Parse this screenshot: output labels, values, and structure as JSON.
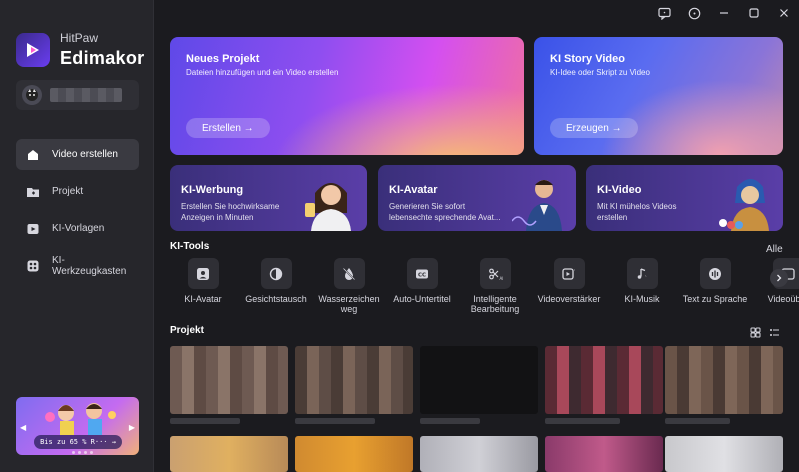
{
  "sidebar": {
    "brand_top": "HitPaw",
    "brand_name": "Edimakor",
    "nav": [
      {
        "label": "Video erstellen",
        "icon": "home-icon",
        "active": true
      },
      {
        "label": "Projekt",
        "icon": "folder-icon",
        "active": false
      },
      {
        "label": "KI-Vorlagen",
        "icon": "template-icon",
        "active": false
      },
      {
        "label": "KI-Werkzeugkasten",
        "icon": "toolbox-icon",
        "active": false
      }
    ],
    "promo_text": "Bis zu 65 % R···"
  },
  "hero": {
    "new_project": {
      "title": "Neues Projekt",
      "subtitle": "Dateien hinzufügen und ein Video erstellen",
      "button": "Erstellen →"
    },
    "story_video": {
      "title": "KI Story Video",
      "subtitle": "KI-Idee oder Skript zu Video",
      "button": "Erzeugen →"
    }
  },
  "features": [
    {
      "title": "KI-Werbung",
      "desc": "Erstellen Sie hochwirksame Anzeigen in Minuten"
    },
    {
      "title": "KI-Avatar",
      "desc": "Generieren Sie sofort lebensechte sprechende Avat..."
    },
    {
      "title": "KI-Video",
      "desc": "Mit KI mühelos Videos erstellen"
    }
  ],
  "tools": {
    "title": "KI-Tools",
    "all_label": "Alle",
    "items": [
      {
        "label": "KI-Avatar",
        "icon": "avatar-icon"
      },
      {
        "label": "Gesichtstausch",
        "icon": "face-swap-icon"
      },
      {
        "label": "Wasserzeichen weg",
        "icon": "watermark-remove-icon"
      },
      {
        "label": "Auto-Untertitel",
        "icon": "subtitle-icon"
      },
      {
        "label": "Intelligente Bearbeitung",
        "icon": "smart-edit-icon"
      },
      {
        "label": "Videoverstärker",
        "icon": "video-enhance-icon"
      },
      {
        "label": "KI-Musik",
        "icon": "music-icon"
      },
      {
        "label": "Text zu Sprache",
        "icon": "tts-icon"
      },
      {
        "label": "Videoüber",
        "icon": "video-translate-icon"
      }
    ]
  },
  "projects": {
    "title": "Projekt"
  }
}
